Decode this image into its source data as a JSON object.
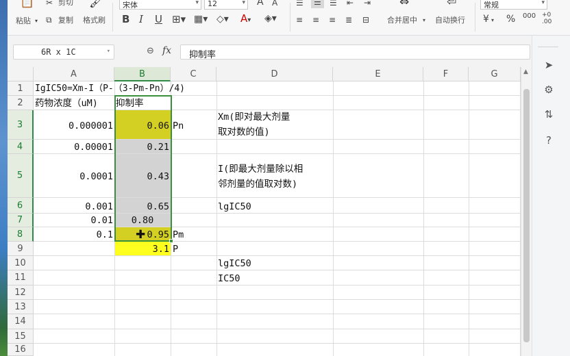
{
  "ribbon": {
    "paste_label": "粘贴",
    "cut_label": "剪切",
    "copy_label": "复制",
    "format_painter_label": "格式刷",
    "font_name": "宋体",
    "font_size": "12",
    "font_grow_icon": "A",
    "font_shrink_icon": "A",
    "bold": "B",
    "italic": "I",
    "underline": "U",
    "merge_center_label": "合并居中",
    "wrap_text_label": "自动换行",
    "number_format": "常规",
    "currency_symbol": "¥",
    "percent_symbol": "%"
  },
  "formula_bar": {
    "name_box": "6R x 1C",
    "fx_label": "fx",
    "content": "抑制率"
  },
  "columns": [
    "A",
    "B",
    "C",
    "D",
    "E",
    "F",
    "G"
  ],
  "rows": [
    "1",
    "2",
    "3",
    "4",
    "5",
    "6",
    "7",
    "8",
    "9",
    "10",
    "11",
    "12",
    "13",
    "14",
    "15",
    "16"
  ],
  "cells": {
    "A1": "IgIC50=Xm-I（P-（3-Pm-Pn）/4)",
    "A2": "药物浓度（uM)",
    "B2": "抑制率",
    "A3": "0.000001",
    "B3": "0.06",
    "C3": "Pn",
    "D3_line1": "Xm(即对最大剂量",
    "D3_line2": "取对数的值)",
    "A4": "0.00001",
    "B4": "0.21",
    "A5": "0.0001",
    "B5": "0.43",
    "D5_line1": "I(即最大剂量除以相",
    "D5_line2": "邻剂量的值取对数)",
    "A6": "0.001",
    "B6": "0.65",
    "D6": "lgIC50",
    "A7": "0.01",
    "B7": "0.80",
    "A8": "0.1",
    "B8": "0.95",
    "C8": "Pm",
    "B9": "3.1",
    "C9": "P",
    "D10": "lgIC50",
    "D11": "IC50"
  },
  "colors": {
    "highlight_olive": "#d4d023",
    "highlight_yellow": "#ffff1f",
    "selection_gray": "#d3d3d3",
    "selection_border": "#3a8f3c"
  }
}
